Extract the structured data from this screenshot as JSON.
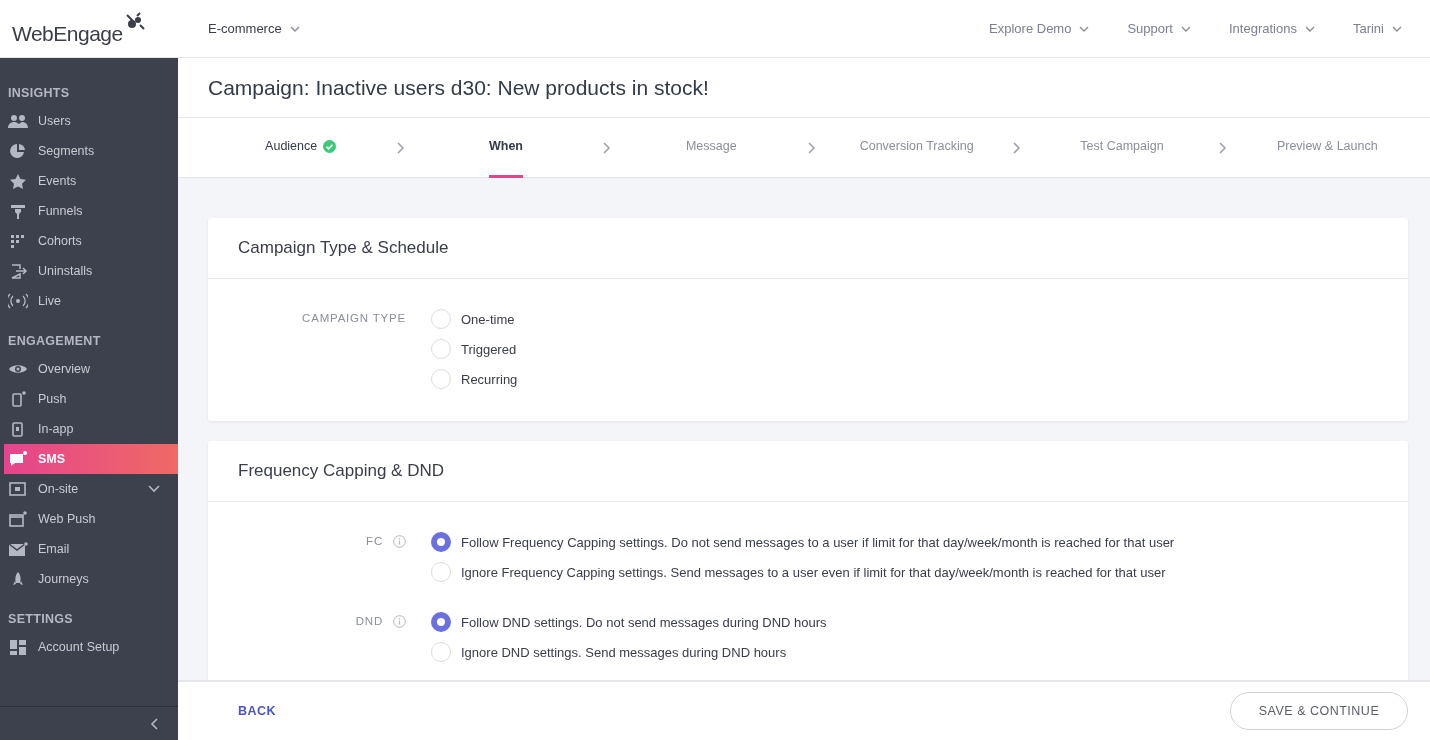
{
  "header": {
    "logo": "WebEngage",
    "project": "E-commerce",
    "menu": [
      {
        "label": "Explore Demo"
      },
      {
        "label": "Support"
      },
      {
        "label": "Integrations"
      },
      {
        "label": "Tarini"
      }
    ]
  },
  "sidebar": {
    "sections": [
      {
        "title": "INSIGHTS",
        "items": [
          {
            "label": "Users",
            "selected": false,
            "expandable": false
          },
          {
            "label": "Segments",
            "selected": false,
            "expandable": false
          },
          {
            "label": "Events",
            "selected": false,
            "expandable": false
          },
          {
            "label": "Funnels",
            "selected": false,
            "expandable": false
          },
          {
            "label": "Cohorts",
            "selected": false,
            "expandable": false
          },
          {
            "label": "Uninstalls",
            "selected": false,
            "expandable": false
          },
          {
            "label": "Live",
            "selected": false,
            "expandable": false
          }
        ]
      },
      {
        "title": "ENGAGEMENT",
        "items": [
          {
            "label": "Overview",
            "selected": false,
            "expandable": false
          },
          {
            "label": "Push",
            "selected": false,
            "expandable": false
          },
          {
            "label": "In-app",
            "selected": false,
            "expandable": false
          },
          {
            "label": "SMS",
            "selected": true,
            "expandable": false
          },
          {
            "label": "On-site",
            "selected": false,
            "expandable": true
          },
          {
            "label": "Web Push",
            "selected": false,
            "expandable": false
          },
          {
            "label": "Email",
            "selected": false,
            "expandable": false
          },
          {
            "label": "Journeys",
            "selected": false,
            "expandable": false
          }
        ]
      },
      {
        "title": "SETTINGS",
        "items": [
          {
            "label": "Account Setup",
            "selected": false,
            "expandable": false
          }
        ]
      }
    ]
  },
  "page": {
    "title": "Campaign: Inactive users d30: New products in stock!"
  },
  "steps": [
    {
      "label": "Audience",
      "selected": false,
      "completed": true
    },
    {
      "label": "When",
      "selected": true,
      "completed": false
    },
    {
      "label": "Message",
      "selected": false,
      "completed": false
    },
    {
      "label": "Conversion Tracking",
      "selected": false,
      "completed": false
    },
    {
      "label": "Test Campaign",
      "selected": false,
      "completed": false
    },
    {
      "label": "Preview & Launch",
      "selected": false,
      "completed": false
    }
  ],
  "cards": [
    {
      "title": "Campaign Type & Schedule",
      "groups": [
        {
          "label": "CAMPAIGN TYPE",
          "info": false,
          "options": [
            {
              "label": "One-time",
              "selected": false
            },
            {
              "label": "Triggered",
              "selected": false
            },
            {
              "label": "Recurring",
              "selected": false
            }
          ]
        }
      ]
    },
    {
      "title": "Frequency Capping & DND",
      "groups": [
        {
          "label": "FC",
          "info": true,
          "options": [
            {
              "label": "Follow Frequency Capping settings. Do not send messages to a user if limit for that day/week/month is reached for that user",
              "selected": true
            },
            {
              "label": "Ignore Frequency Capping settings. Send messages to a user even if limit for that day/week/month is reached for that user",
              "selected": false
            }
          ]
        },
        {
          "label": "DND",
          "info": true,
          "options": [
            {
              "label": "Follow DND settings. Do not send messages during DND hours",
              "selected": true
            },
            {
              "label": "Ignore DND settings. Send messages during DND hours",
              "selected": false
            }
          ]
        }
      ]
    }
  ],
  "footer": {
    "back": "BACK",
    "save": "SAVE & CONTINUE"
  }
}
